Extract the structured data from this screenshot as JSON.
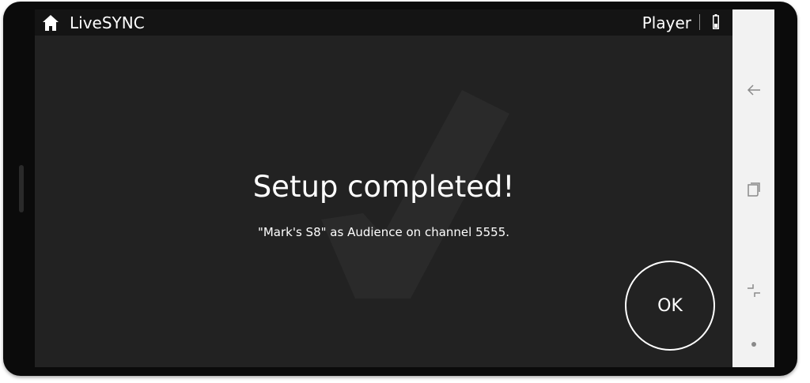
{
  "status_bar": {
    "home_icon": "home-icon",
    "app_title": "LiveSYNC",
    "role": "Player",
    "battery_icon": "battery-icon"
  },
  "main": {
    "title": "Setup completed!",
    "subtitle": "\"Mark's S8\" as Audience on channel 5555.",
    "watermark_icon": "checkmark-icon",
    "ok_label": "OK"
  },
  "nav_bar": {
    "icons": [
      "back-icon",
      "recents-icon",
      "switch-apps-icon",
      "dot-icon"
    ]
  },
  "colors": {
    "screen_background": "#222222",
    "status_bar_background": "#141414",
    "nav_bar_background": "#f2f2f2",
    "text": "#ffffff"
  }
}
